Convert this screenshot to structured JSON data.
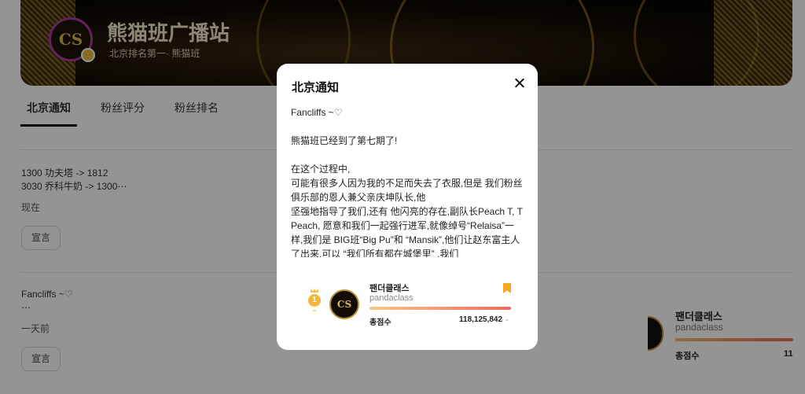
{
  "channel": {
    "title": "熊猫班广播站",
    "subtitle": "北京排名第一· 熊猫班",
    "avatar_text": "CS"
  },
  "tabs": [
    {
      "label": "北京通知",
      "active": true
    },
    {
      "label": "粉丝评分",
      "active": false
    },
    {
      "label": "粉丝排名",
      "active": false
    }
  ],
  "posts": [
    {
      "lines": [
        "1300 功夫塔 -> 1812",
        "3030 乔科牛奶 -> 1300⋯"
      ],
      "time": "现在",
      "button": "宣言"
    },
    {
      "lines": [
        "Fancliffs ~♡",
        "⋯"
      ],
      "time": "一天前",
      "button": "宣言"
    }
  ],
  "side_card": {
    "name": "팬더클래스",
    "handle": "pandaclass",
    "total_label": "총점수",
    "total_value": "11"
  },
  "modal": {
    "title": "北京通知",
    "body": [
      "Fancliffs ~♡",
      "",
      "熊猫班已经到了第七期了!",
      "",
      "在这个过程中,",
      "可能有很多人因为我的不足而失去了衣服,但是 我们粉丝俱乐部的恩人兼父亲庆坤队长,他",
      "坚强地指导了我们,还有 他闪亮的存在,副队长Peach T, T Peach, 愿意和我们一起强行进军,就像绰号“Relaisa”一样,我们是 BIG班“Big Pu”和 “Mansik”,他们让赵东富主人了出来,可以 “我们所有都在城堡里” ,我们"
    ],
    "rank_card": {
      "name": "팬더클래스",
      "handle": "pandaclass",
      "avatar_text": "CS",
      "medal": "1",
      "total_label": "총점수",
      "total_value": "118,125,842",
      "chevron": "⌄"
    }
  },
  "colors": {
    "accent_bar_start": "#f9c58a",
    "accent_bar_end": "#ee6b5a",
    "bookmark": "#f5a623",
    "medal": "#f2b73a"
  }
}
